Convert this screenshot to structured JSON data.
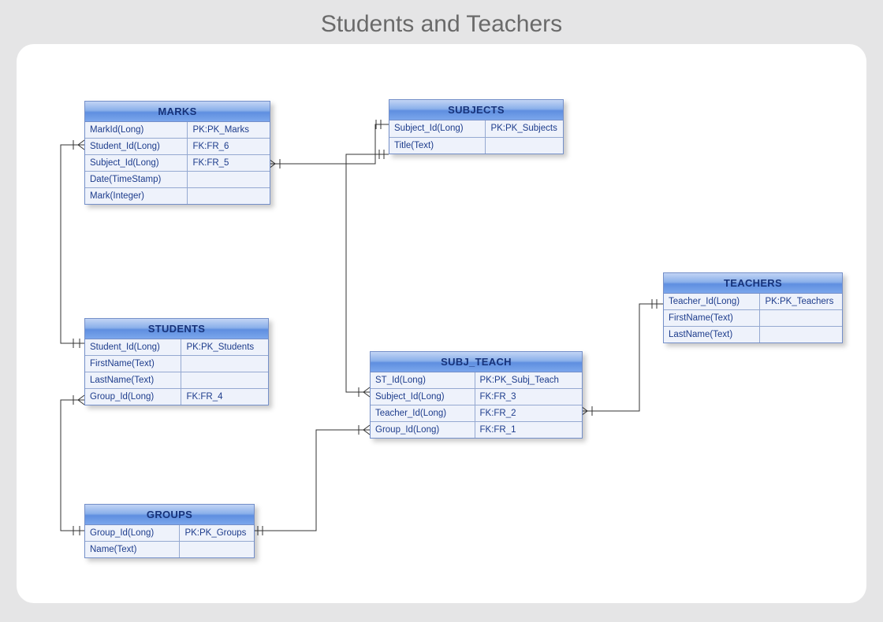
{
  "title": "Students and Teachers",
  "entities": {
    "marks": {
      "name": "MARKS",
      "rows": [
        {
          "field": "MarkId(Long)",
          "key": "PK:PK_Marks"
        },
        {
          "field": "Student_Id(Long)",
          "key": "FK:FR_6"
        },
        {
          "field": "Subject_Id(Long)",
          "key": "FK:FR_5"
        },
        {
          "field": "Date(TimeStamp)",
          "key": ""
        },
        {
          "field": "Mark(Integer)",
          "key": ""
        }
      ]
    },
    "subjects": {
      "name": "SUBJECTS",
      "rows": [
        {
          "field": "Subject_Id(Long)",
          "key": "PK:PK_Subjects"
        },
        {
          "field": "Title(Text)",
          "key": ""
        }
      ]
    },
    "students": {
      "name": "STUDENTS",
      "rows": [
        {
          "field": "Student_Id(Long)",
          "key": "PK:PK_Students"
        },
        {
          "field": "FirstName(Text)",
          "key": ""
        },
        {
          "field": "LastName(Text)",
          "key": ""
        },
        {
          "field": "Group_Id(Long)",
          "key": "FK:FR_4"
        }
      ]
    },
    "subj_teach": {
      "name": "SUBJ_TEACH",
      "rows": [
        {
          "field": "ST_Id(Long)",
          "key": "PK:PK_Subj_Teach"
        },
        {
          "field": "Subject_Id(Long)",
          "key": "FK:FR_3"
        },
        {
          "field": "Teacher_Id(Long)",
          "key": "FK:FR_2"
        },
        {
          "field": "Group_Id(Long)",
          "key": "FK:FR_1"
        }
      ]
    },
    "teachers": {
      "name": "TEACHERS",
      "rows": [
        {
          "field": "Teacher_Id(Long)",
          "key": "PK:PK_Teachers"
        },
        {
          "field": "FirstName(Text)",
          "key": ""
        },
        {
          "field": "LastName(Text)",
          "key": ""
        }
      ]
    },
    "groups": {
      "name": "GROUPS",
      "rows": [
        {
          "field": "Group_Id(Long)",
          "key": "PK:PK_Groups"
        },
        {
          "field": "Name(Text)",
          "key": ""
        }
      ]
    }
  }
}
